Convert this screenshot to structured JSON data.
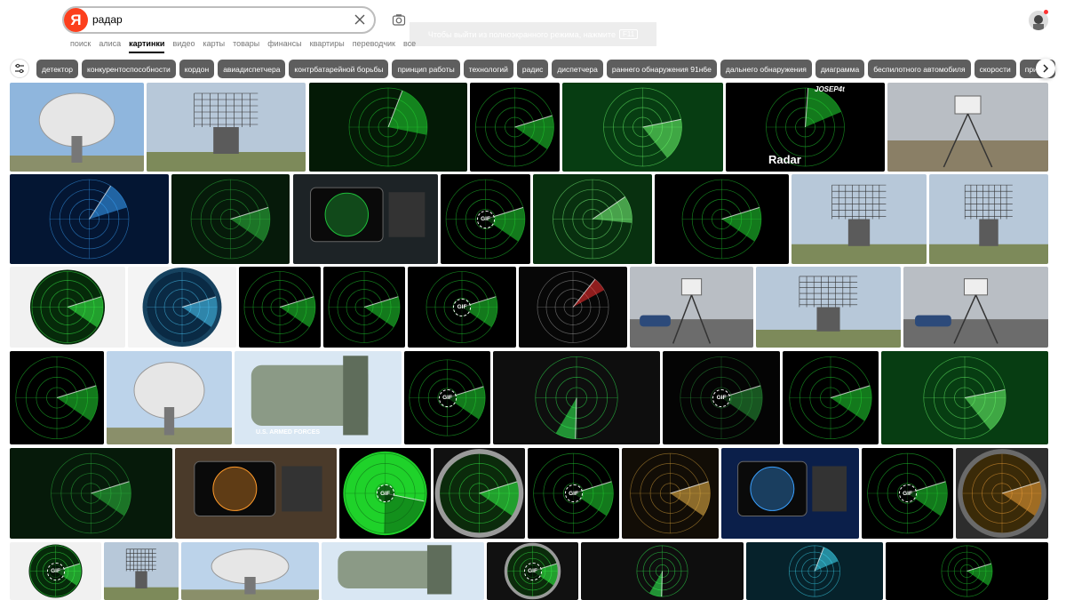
{
  "search": {
    "query": "радар",
    "logo_letter": "Я"
  },
  "toast": {
    "text": "Чтобы выйти из полноэкранного режима, нажмите",
    "key": "F11"
  },
  "nav": {
    "items": [
      {
        "label": "поиск",
        "active": false
      },
      {
        "label": "алиса",
        "active": false
      },
      {
        "label": "картинки",
        "active": true
      },
      {
        "label": "видео",
        "active": false
      },
      {
        "label": "карты",
        "active": false
      },
      {
        "label": "товары",
        "active": false
      },
      {
        "label": "финансы",
        "active": false
      },
      {
        "label": "квартиры",
        "active": false
      },
      {
        "label": "переводчик",
        "active": false
      },
      {
        "label": "все",
        "active": false
      }
    ]
  },
  "chips": [
    "детектор",
    "конкурентоспособности",
    "кордон",
    "авиадиспетчера",
    "контрбатарейной борьбы",
    "принцип работы",
    "технологий",
    "радис",
    "диспетчера",
    "раннего обнаружения 91н6е",
    "дальнего обнаружения",
    "диаграмма",
    "беспилотного автомобиля",
    "скорости",
    "прибор"
  ],
  "images": {
    "gif_label": "GIF",
    "radar_caption": "Radar",
    "josep_caption": "JOSEP4t",
    "armed_forces_caption": "U.S. ARMED FORCES"
  },
  "icons": {
    "clear": "close-icon",
    "camera": "camera-icon",
    "filter": "filter-icon",
    "next": "chevron-right-icon",
    "avatar": "avatar-icon"
  },
  "colors": {
    "brand": "#fc3f1d",
    "chip_bg": "#5e5e5e",
    "radar_green": "#22dd33"
  }
}
